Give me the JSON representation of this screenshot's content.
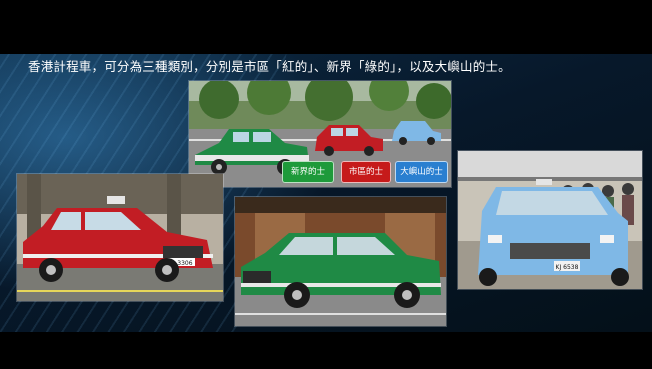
{
  "slide": {
    "title": "香港計程車，可分為三種類別，分別是市區「紅的」、新界「綠的」，以及大嶼山的士。"
  },
  "legend": {
    "green_label": "新界的士",
    "red_label": "市區的士",
    "blue_label": "大嶼山的士"
  },
  "plates": {
    "red_taxi": "JB 3306",
    "blue_taxi": "KJ 6538"
  },
  "colors": {
    "red_taxi": "#c21d24",
    "green_taxi": "#1f8a45",
    "blue_taxi": "#7fb8e6",
    "legend_green": "#1e9a3a",
    "legend_red": "#c61a1a",
    "legend_blue": "#2a7fd0"
  },
  "icons": {
    "taxi_sign": "taxi-roof-sign-icon"
  }
}
